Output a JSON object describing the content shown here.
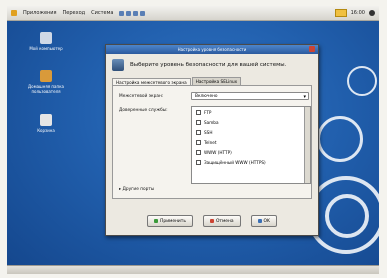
{
  "panel": {
    "menu_items": [
      "Приложения",
      "Переход",
      "Система"
    ],
    "clock": "16:00"
  },
  "desktop": {
    "icons": [
      {
        "label": "Мой компьютер",
        "icon": "computer-icon"
      },
      {
        "label": "Домашняя папка пользователя",
        "icon": "home-folder-icon"
      },
      {
        "label": "Корзина",
        "icon": "trash-icon"
      }
    ]
  },
  "dialog": {
    "title": "Настройка уровня безопасности",
    "header": "Выберите уровень безопасности для вашей системы.",
    "tabs": [
      {
        "label": "Настройка межсетевого экрана",
        "active": true
      },
      {
        "label": "Настройка SELinux",
        "active": false
      }
    ],
    "firewall_label": "Межсетевой экран:",
    "firewall_value": "Включено",
    "services_label": "Доверенные службы:",
    "services": [
      "FTP",
      "Samba",
      "SSH",
      "Telnet",
      "WWW (HTTP)",
      "Защищённый WWW (HTTPS)"
    ],
    "other_ports": "Другие порты",
    "buttons": {
      "apply": "Применить",
      "cancel": "Отмена",
      "ok": "OK"
    }
  }
}
